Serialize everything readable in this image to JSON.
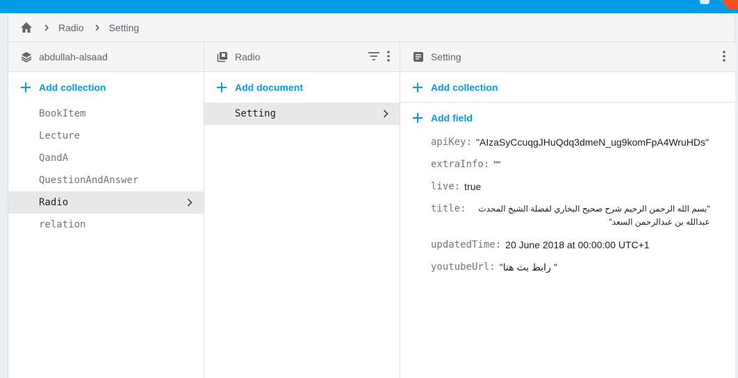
{
  "breadcrumb": {
    "items": [
      "Radio",
      "Setting"
    ]
  },
  "colors": {
    "accent": "#039be5",
    "topbar": "#039be5",
    "avatar": "#f4511e"
  },
  "col1": {
    "title": "abdullah-alsaad",
    "add_label": "Add collection",
    "items": [
      "BookItem",
      "Lecture",
      "QandA",
      "QuestionAndAnswer",
      "Radio",
      "relation"
    ],
    "selected": "Radio"
  },
  "col2": {
    "title": "Radio",
    "add_label": "Add document",
    "items": [
      "Setting"
    ],
    "selected": "Setting"
  },
  "col3": {
    "title": "Setting",
    "add_collection_label": "Add collection",
    "add_field_label": "Add field",
    "fields": [
      {
        "key": "apiKey:",
        "value": "\"AIzaSyCcuqgJHuQdq3dmeN_ug9komFpA4WruHDs\""
      },
      {
        "key": "extraInfo:",
        "value": "\"\""
      },
      {
        "key": "live:",
        "value": "true"
      },
      {
        "key": "title:",
        "value": "\"بسم الله الرحمن الرحيم شرح صحيح البخاري لفضلة الشيخ المحدث عبدالله بن عبدالرحمن السعد\""
      },
      {
        "key": "updatedTime:",
        "value": "20 June 2018 at 00:00:00 UTC+1"
      },
      {
        "key": "youtubeUrl:",
        "value": "\"رابط بث هنا \""
      }
    ]
  }
}
